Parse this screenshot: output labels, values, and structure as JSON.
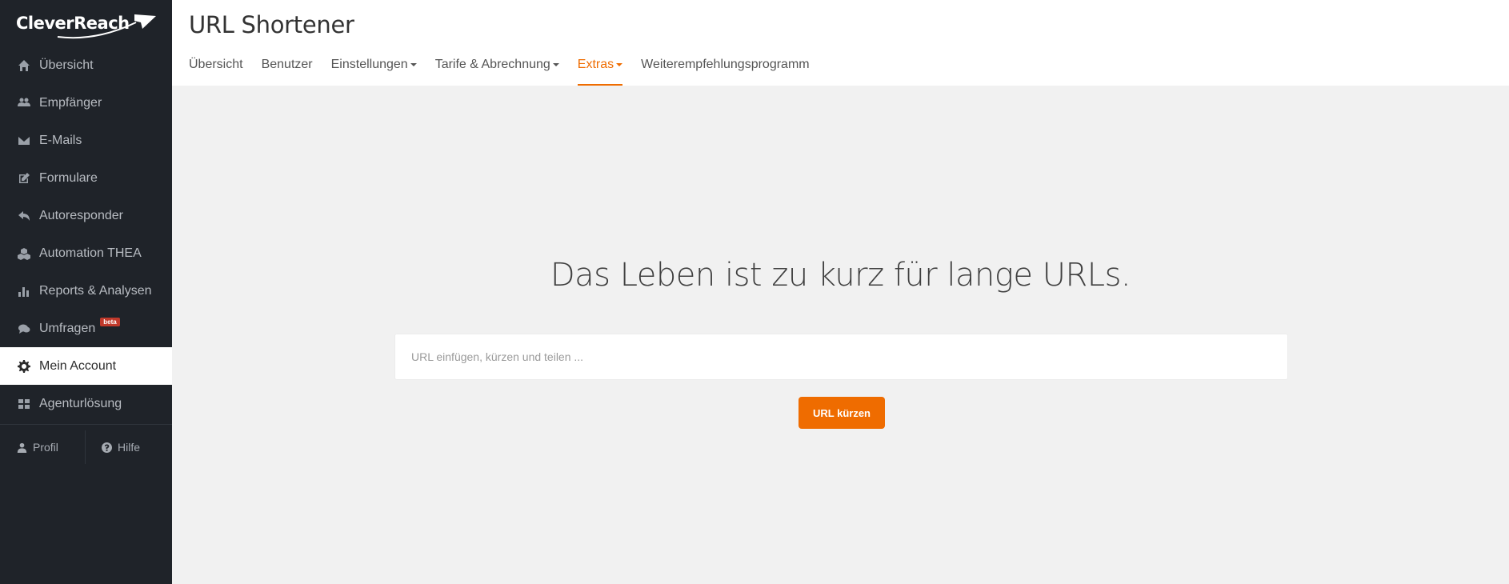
{
  "brand": {
    "name": "CleverReach"
  },
  "sidebar": {
    "items": [
      {
        "label": "Übersicht",
        "icon": "home-icon"
      },
      {
        "label": "Empfänger",
        "icon": "users-icon"
      },
      {
        "label": "E-Mails",
        "icon": "envelope-icon"
      },
      {
        "label": "Formulare",
        "icon": "edit-icon"
      },
      {
        "label": "Autoresponder",
        "icon": "reply-icon"
      },
      {
        "label": "Automation THEA",
        "icon": "cubes-icon"
      },
      {
        "label": "Reports & Analysen",
        "icon": "bar-chart-icon"
      },
      {
        "label": "Umfragen",
        "icon": "comments-icon",
        "badge": "beta"
      },
      {
        "label": "Mein Account",
        "icon": "gear-icon",
        "active": true
      },
      {
        "label": "Agenturlösung",
        "icon": "grid-icon"
      }
    ],
    "bottom": {
      "profile": "Profil",
      "help": "Hilfe"
    }
  },
  "header": {
    "title": "URL Shortener",
    "tabs": [
      {
        "label": "Übersicht"
      },
      {
        "label": "Benutzer"
      },
      {
        "label": "Einstellungen",
        "dropdown": true
      },
      {
        "label": "Tarife & Abrechnung",
        "dropdown": true
      },
      {
        "label": "Extras",
        "dropdown": true,
        "active": true
      },
      {
        "label": "Weiterempfehlungsprogramm"
      }
    ]
  },
  "main": {
    "headline": "Das Leben ist zu kurz für lange URLs.",
    "input": {
      "placeholder": "URL einfügen, kürzen und teilen ...",
      "value": ""
    },
    "button_label": "URL kürzen"
  },
  "colors": {
    "accent": "#ef6c00",
    "sidebar_bg": "#1f2329",
    "content_bg": "#f1f1f1",
    "badge": "#c0392b"
  }
}
